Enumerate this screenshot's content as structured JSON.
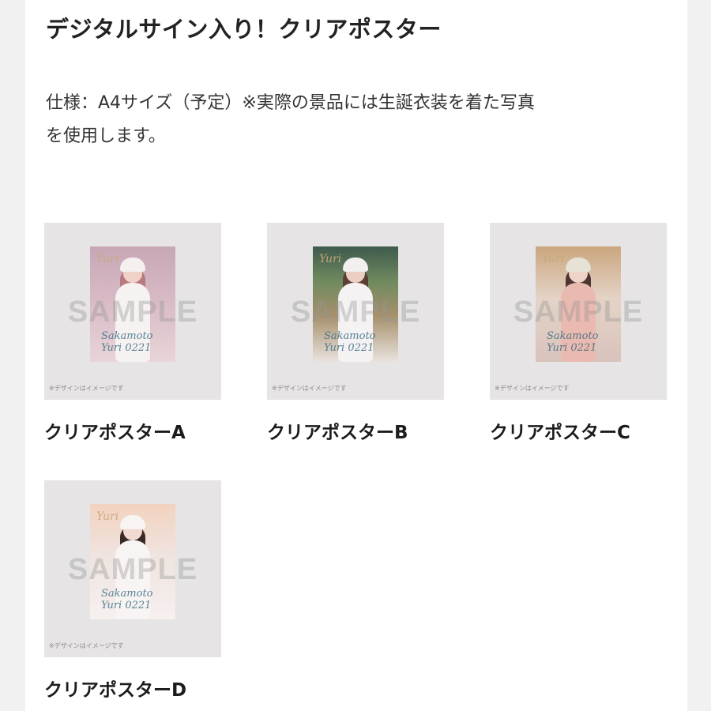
{
  "header": {
    "title": "デジタルサイン入り！クリアポスター"
  },
  "description": {
    "line1": "仕様：A4サイズ（予定）※実際の景品には生誕衣装を着た写真",
    "line2": "を使用します。"
  },
  "products": [
    {
      "label": "クリアポスターA",
      "watermark": "SAMPLE",
      "note": "※デザインはイメージです",
      "script_line1": "Sakamoto",
      "script_line2": "Yuri 0221"
    },
    {
      "label": "クリアポスターB",
      "watermark": "SAMPLE",
      "note": "※デザインはイメージです",
      "script_line1": "Sakamoto",
      "script_line2": "Yuri 0221"
    },
    {
      "label": "クリアポスターC",
      "watermark": "SAMPLE",
      "note": "※デザインはイメージです",
      "script_line1": "Sakamoto",
      "script_line2": "Yuri 0221"
    },
    {
      "label": "クリアポスターD",
      "watermark": "SAMPLE",
      "note": "※デザインはイメージです",
      "script_line1": "Sakamoto",
      "script_line2": "Yuri 0221"
    }
  ]
}
